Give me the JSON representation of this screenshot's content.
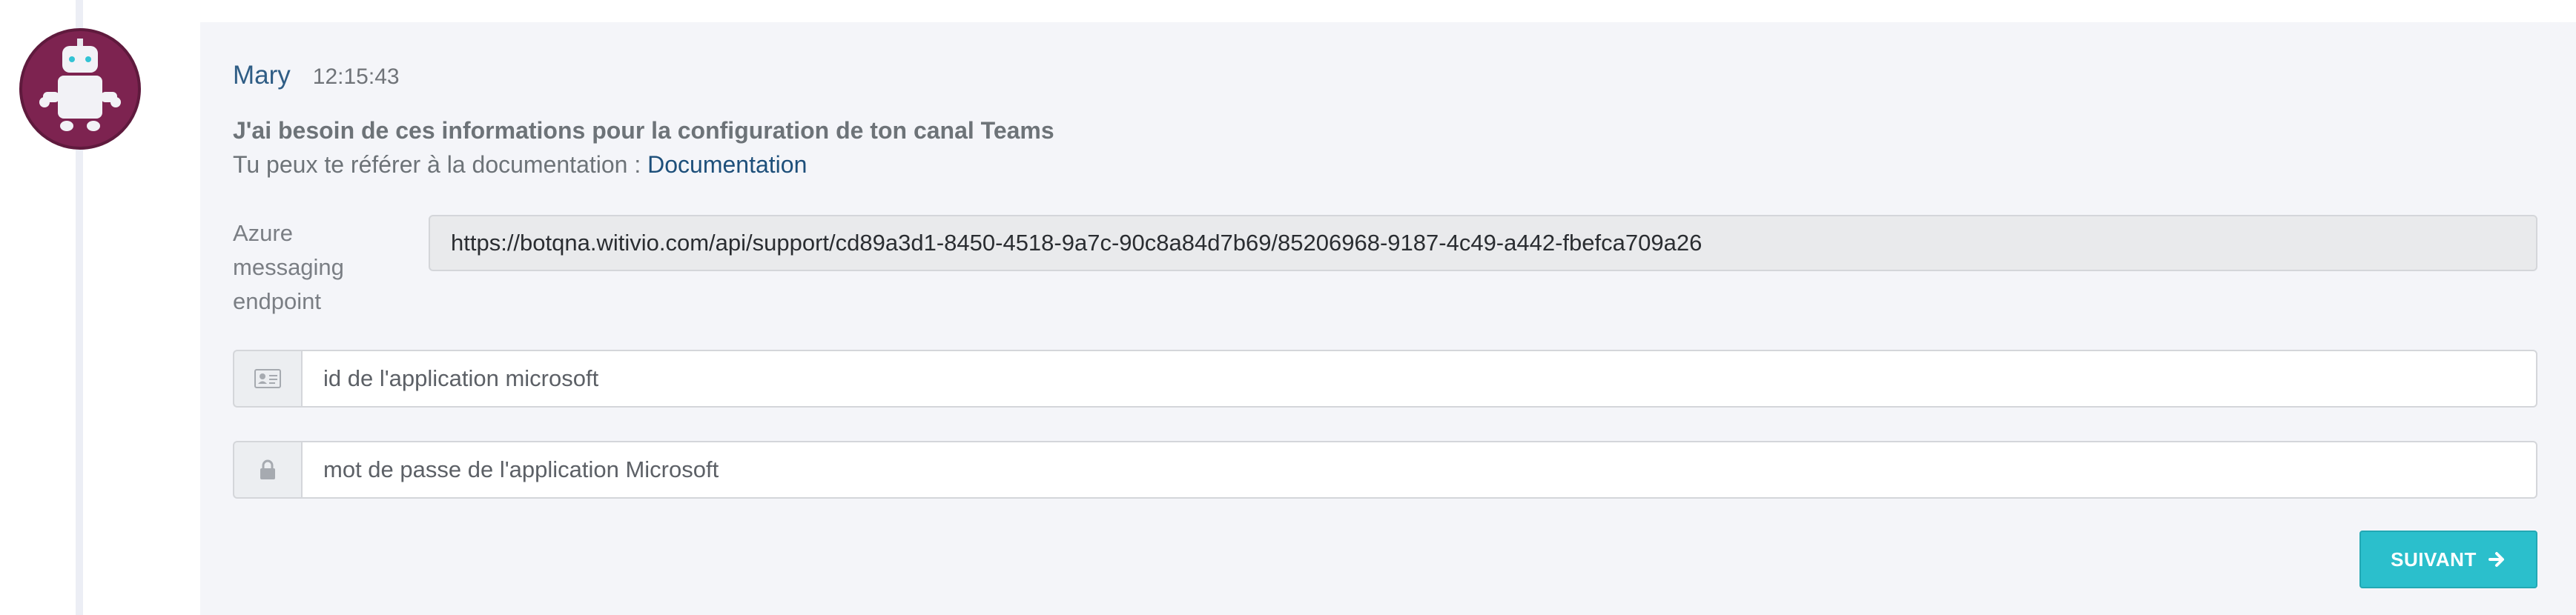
{
  "message": {
    "sender": "Mary",
    "time": "12:15:43",
    "title": "J'ai besoin de ces informations pour la configuration de ton canal Teams",
    "subtitle_prefix": "Tu peux te référer à la documentation : ",
    "doc_link": "Documentation"
  },
  "form": {
    "endpoint_label_line1": "Azure",
    "endpoint_label_line2": "messaging",
    "endpoint_label_line3": "endpoint",
    "endpoint_value": "https://botqna.witivio.com/api/support/cd89a3d1-8450-4518-9a7c-90c8a84d7b69/85206968-9187-4c49-a442-fbefca709a26",
    "app_id_placeholder": "id de l'application microsoft",
    "app_password_placeholder": "mot de passe de l'application Microsoft",
    "next_label": "SUIVANT"
  },
  "icons": {
    "avatar": "robot-avatar-icon",
    "id_card": "id-card-icon",
    "lock": "lock-icon",
    "arrow": "arrow-right-icon"
  },
  "colors": {
    "avatar_bg": "#7d2350",
    "sender": "#2f5d85",
    "link": "#1d4f7a",
    "button": "#2bbfcc",
    "card_bg": "#f4f5f9"
  }
}
